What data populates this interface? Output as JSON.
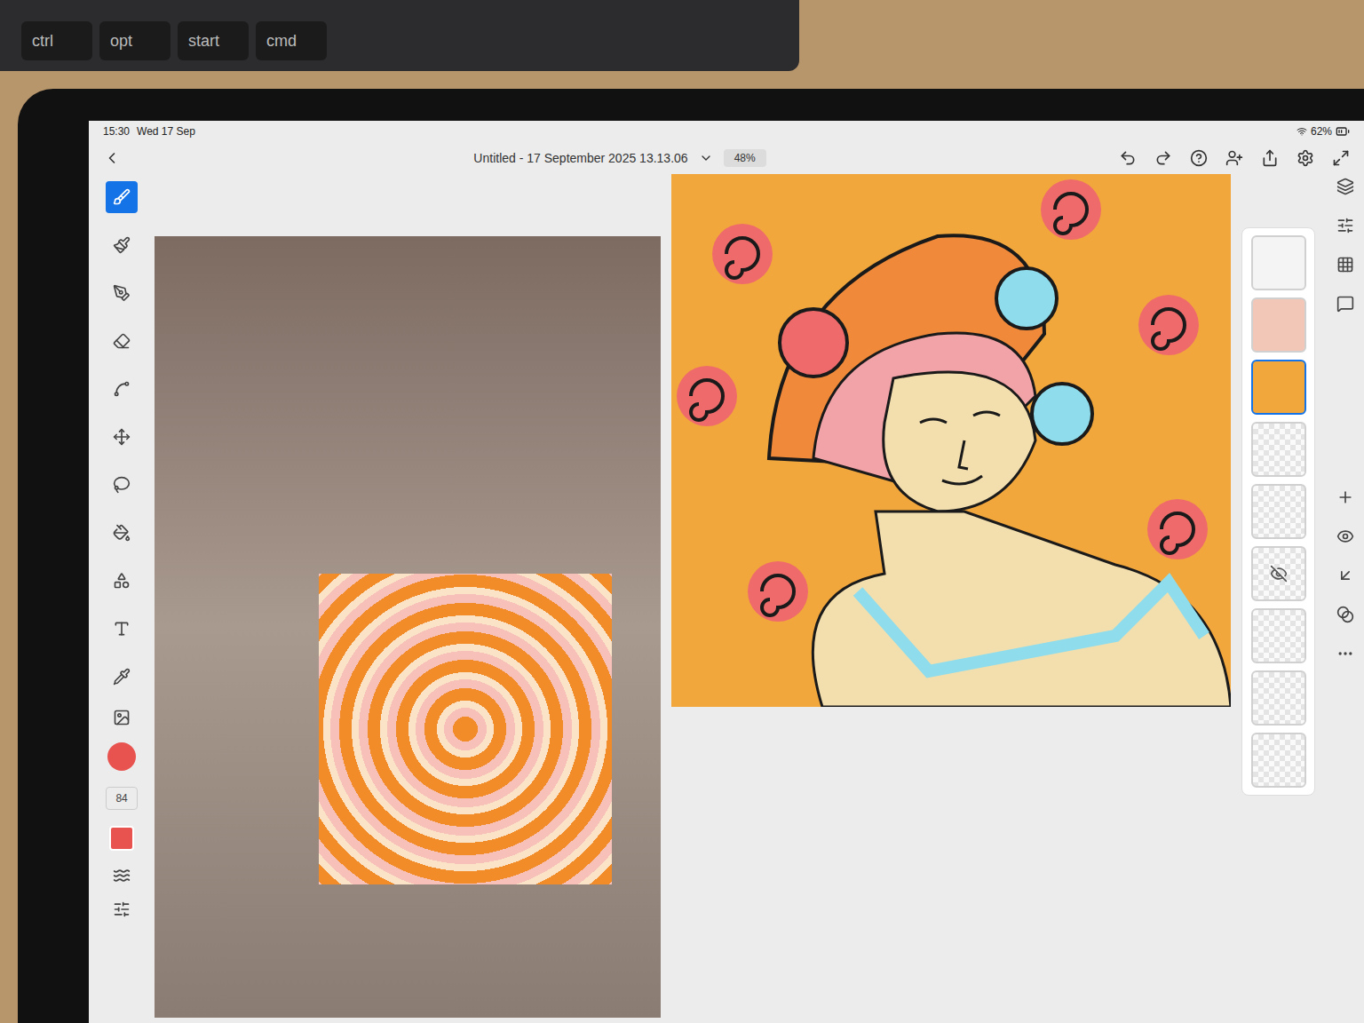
{
  "keyboard": {
    "keys": [
      "ctrl",
      "opt",
      "start",
      "cmd"
    ]
  },
  "status_bar": {
    "time": "15:30",
    "date": "Wed 17 Sep",
    "battery": "62%"
  },
  "document": {
    "title": "Untitled - 17 September 2025 13.13.06",
    "zoom": "48%"
  },
  "brush": {
    "size": "84"
  },
  "tools": [
    {
      "selected": true
    },
    {
      "selected": false
    },
    {
      "selected": false
    },
    {
      "selected": false
    },
    {
      "selected": false
    },
    {
      "selected": false
    },
    {
      "selected": false
    },
    {
      "selected": false
    },
    {
      "selected": false
    },
    {
      "selected": false
    },
    {
      "selected": false
    }
  ],
  "layers": [
    {
      "kind": "sketch",
      "selected": false,
      "hidden": false
    },
    {
      "kind": "color",
      "selected": false,
      "hidden": false
    },
    {
      "kind": "background",
      "selected": true,
      "hidden": false
    },
    {
      "kind": "empty",
      "selected": false,
      "hidden": false
    },
    {
      "kind": "empty",
      "selected": false,
      "hidden": false
    },
    {
      "kind": "empty",
      "selected": false,
      "hidden": true
    },
    {
      "kind": "empty",
      "selected": false,
      "hidden": false
    },
    {
      "kind": "empty",
      "selected": false,
      "hidden": false
    },
    {
      "kind": "empty",
      "selected": false,
      "hidden": false
    }
  ]
}
